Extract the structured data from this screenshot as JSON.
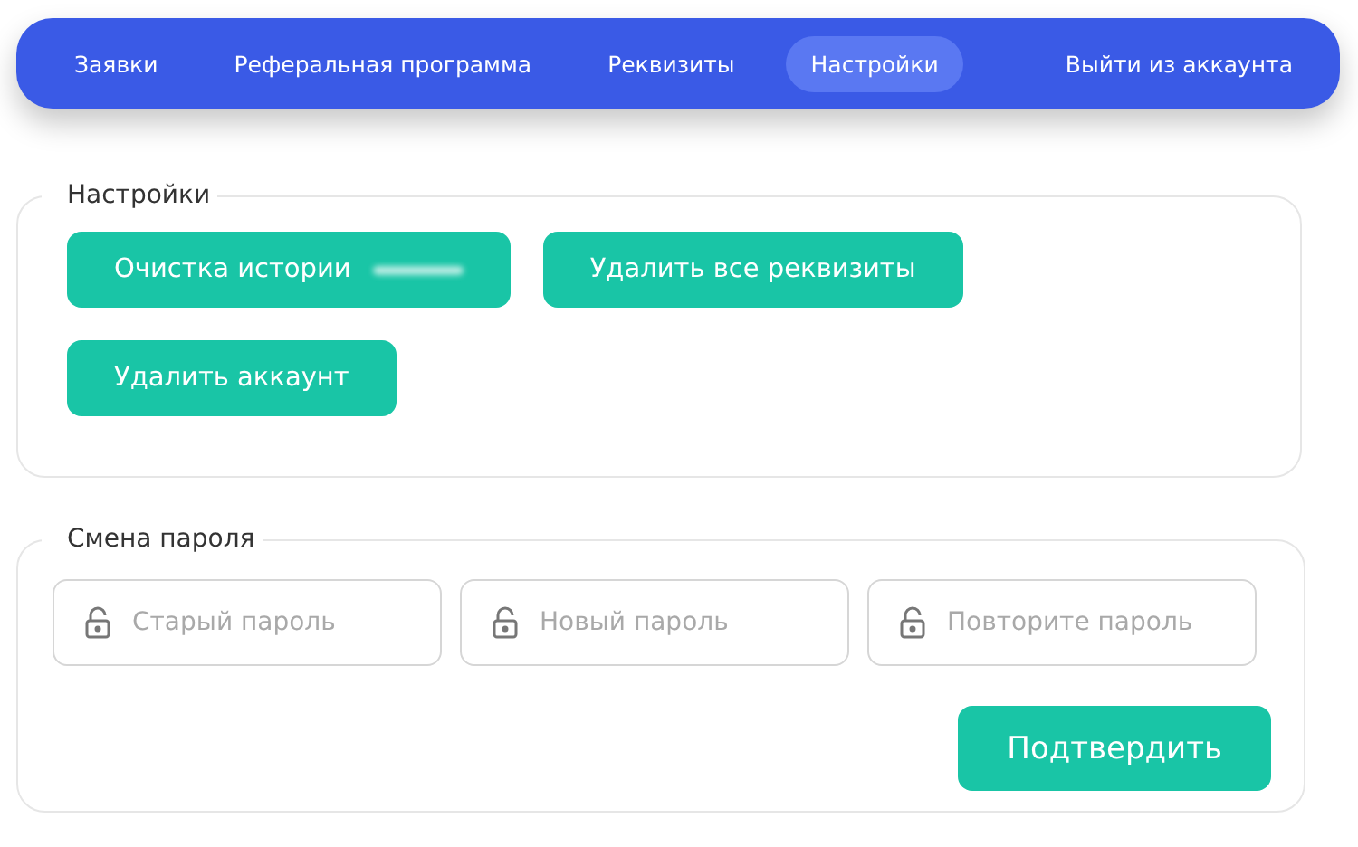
{
  "nav": {
    "items": [
      {
        "label": "Заявки",
        "selected": false
      },
      {
        "label": "Реферальная программа",
        "selected": false
      },
      {
        "label": "Реквизиты",
        "selected": false
      },
      {
        "label": "Настройки",
        "selected": true
      }
    ],
    "logout": "Выйти из аккаунта"
  },
  "settings": {
    "title": "Настройки",
    "buttons": [
      {
        "label": "Очистка истории",
        "blurred": true
      },
      {
        "label": "Удалить все реквизиты",
        "blurred": false
      },
      {
        "label": "Удалить аккаунт",
        "blurred": false
      }
    ]
  },
  "password": {
    "title": "Смена пароля",
    "fields": [
      {
        "placeholder": "Старый пароль"
      },
      {
        "placeholder": "Новый пароль"
      },
      {
        "placeholder": "Повторите пароль"
      }
    ],
    "submit": "Подтвердить"
  }
}
